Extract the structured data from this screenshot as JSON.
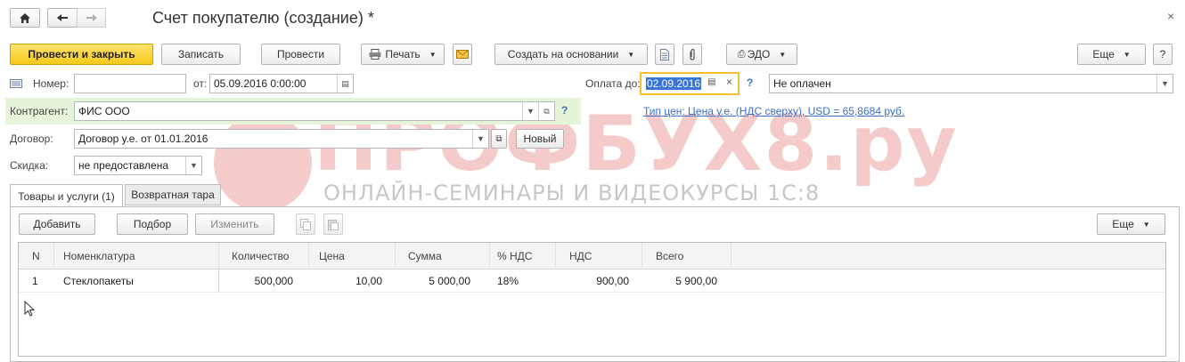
{
  "window": {
    "title": "Счет покупателю (создание) *"
  },
  "toolbar": {
    "post_and_close": "Провести и закрыть",
    "save": "Записать",
    "post": "Провести",
    "print": "Печать",
    "create_based_on": "Создать на основании",
    "edo": "ЭДО",
    "more": "Еще",
    "help": "?"
  },
  "form": {
    "number_label": "Номер:",
    "number_value": "",
    "date_label": "от:",
    "date_value": "05.09.2016  0:00:00",
    "payment_label": "Оплата до:",
    "payment_value": "02.09.2016",
    "payment_status": "Не оплачен",
    "contractor_label": "Контрагент:",
    "contractor_value": "ФИС ООО",
    "contract_label": "Договор:",
    "contract_value": "Договор у.е. от 01.01.2016",
    "new_button": "Новый",
    "discount_label": "Скидка:",
    "discount_value": "не предоставлена",
    "price_type_link": "Тип цен: Цена у.е. (НДС сверху), USD = 65,8684 руб.",
    "help": "?"
  },
  "watermark": {
    "title": "ПРОФБУХ8.ру",
    "subtitle": "ОНЛАЙН-СЕМИНАРЫ И ВИДЕОКУРСЫ 1С:8"
  },
  "tabs": [
    {
      "label": "Товары и услуги (1)"
    },
    {
      "label": "Возвратная тара"
    }
  ],
  "table_toolbar": {
    "add": "Добавить",
    "select": "Подбор",
    "edit": "Изменить",
    "more": "Еще"
  },
  "table": {
    "columns": [
      "N",
      "Номенклатура",
      "Количество",
      "Цена",
      "Сумма",
      "% НДС",
      "НДС",
      "Всего"
    ],
    "rows": [
      [
        "1",
        "Стеклопакеты",
        "500,000",
        "10,00",
        "5 000,00",
        "18%",
        "900,00",
        "5 900,00"
      ]
    ]
  },
  "icons": {
    "home": "home-icon",
    "back": "arrow-left-icon",
    "forward": "arrow-right-icon",
    "close": "close-icon",
    "printer": "printer-icon",
    "envelope": "envelope-icon",
    "document": "document-icon",
    "attachment": "paperclip-icon",
    "calendar": "calendar-icon"
  },
  "colors": {
    "primary_button": "#f5c91a",
    "highlight_row": "#e6f4d9",
    "link": "#3b6fc4",
    "watermark": "#e98b8b"
  }
}
